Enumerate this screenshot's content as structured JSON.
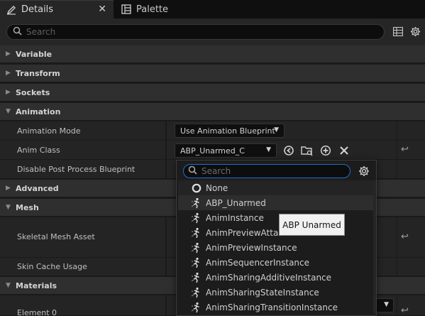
{
  "tabs": [
    {
      "label": "Details",
      "icon": "pencil-icon",
      "active": true
    },
    {
      "label": "Palette",
      "icon": "palette-list-icon",
      "active": false
    }
  ],
  "search": {
    "placeholder": "Search"
  },
  "categories": {
    "variable": "Variable",
    "transform": "Transform",
    "sockets": "Sockets",
    "animation": "Animation",
    "advanced": "Advanced",
    "mesh": "Mesh",
    "materials": "Materials"
  },
  "properties": {
    "animation_mode": {
      "label": "Animation Mode",
      "value": "Use Animation Blueprint"
    },
    "anim_class": {
      "label": "Anim Class",
      "value": "ABP_Unarmed_C"
    },
    "disable_post_process": {
      "label": "Disable Post Process Blueprint"
    },
    "skeletal_mesh_asset": {
      "label": "Skeletal Mesh Asset"
    },
    "skin_cache_usage": {
      "label": "Skin Cache Usage"
    },
    "element_0": {
      "label": "Element 0"
    }
  },
  "picker": {
    "search_placeholder": "Search",
    "items": [
      "None",
      "ABP_Unarmed",
      "AnimInstance",
      "AnimPreviewAttac",
      "AnimPreviewInstance",
      "AnimSequencerInstance",
      "AnimSharingAdditiveInstance",
      "AnimSharingStateInstance",
      "AnimSharingTransitionInstance"
    ],
    "hovered_index": 1
  },
  "tooltip": {
    "text": "ABP Unarmed"
  },
  "colors": {
    "accent_focus": "#1f6fd1",
    "panel_bg": "#242424",
    "category_bg": "#2f2f2f"
  }
}
